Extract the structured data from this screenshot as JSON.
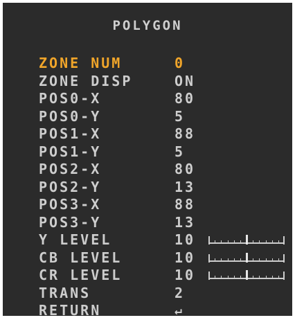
{
  "menu": {
    "title": "POLYGON",
    "items": [
      {
        "label": "ZONE NUM",
        "value": "0"
      },
      {
        "label": "ZONE DISP",
        "value": "ON"
      },
      {
        "label": "POS0-X",
        "value": "80"
      },
      {
        "label": "POS0-Y",
        "value": "5"
      },
      {
        "label": "POS1-X",
        "value": "88"
      },
      {
        "label": "POS1-Y",
        "value": "5"
      },
      {
        "label": "POS2-X",
        "value": "80"
      },
      {
        "label": "POS2-Y",
        "value": "13"
      },
      {
        "label": "POS3-X",
        "value": "88"
      },
      {
        "label": "POS3-Y",
        "value": "13"
      },
      {
        "label": "Y LEVEL",
        "value": "10",
        "slider_level": 0.5
      },
      {
        "label": "CB LEVEL",
        "value": "10",
        "slider_level": 0.5
      },
      {
        "label": "CR LEVEL",
        "value": "10",
        "slider_level": 0.5
      },
      {
        "label": "TRANS",
        "value": "2"
      },
      {
        "label": "RETURN",
        "value": "↵"
      }
    ],
    "selected_index": 0
  },
  "colors": {
    "background": "#2b2b2b",
    "text": "#cdcdcd",
    "selected": "#f0a52a"
  },
  "icons": {
    "return": "enter-return-icon"
  }
}
